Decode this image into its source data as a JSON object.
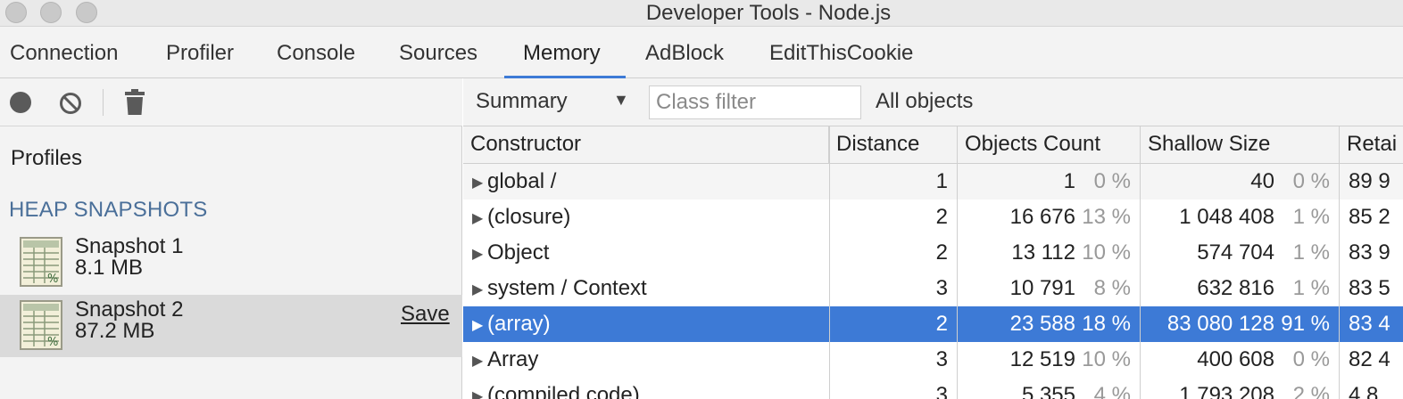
{
  "window": {
    "title": "Developer Tools - Node.js"
  },
  "tabs": [
    {
      "label": "Connection",
      "active": false
    },
    {
      "label": "Profiler",
      "active": false
    },
    {
      "label": "Console",
      "active": false
    },
    {
      "label": "Sources",
      "active": false
    },
    {
      "label": "Memory",
      "active": true
    },
    {
      "label": "AdBlock",
      "active": false
    },
    {
      "label": "EditThisCookie",
      "active": false
    }
  ],
  "sidebar": {
    "profiles_label": "Profiles",
    "section_label": "HEAP SNAPSHOTS",
    "snapshots": [
      {
        "name": "Snapshot 1",
        "size": "8.1 MB",
        "selected": false,
        "save_label": ""
      },
      {
        "name": "Snapshot 2",
        "size": "87.2 MB",
        "selected": true,
        "save_label": "Save"
      }
    ]
  },
  "toolbar": {
    "view": "Summary",
    "class_filter_placeholder": "Class filter",
    "class_filter_value": "",
    "scope": "All objects"
  },
  "table": {
    "columns": [
      "Constructor",
      "Distance",
      "Objects Count",
      "Shallow Size",
      "Retai"
    ],
    "rows": [
      {
        "name": "global /",
        "distance": "1",
        "count": "1",
        "count_pct": "0 %",
        "shallow": "40",
        "shallow_pct": "0 %",
        "retained": "89 9",
        "style": "alt"
      },
      {
        "name": "(closure)",
        "distance": "2",
        "count": "16 676",
        "count_pct": "13 %",
        "shallow": "1 048 408",
        "shallow_pct": "1 %",
        "retained": "85 2",
        "style": ""
      },
      {
        "name": "Object",
        "distance": "2",
        "count": "13 112",
        "count_pct": "10 %",
        "shallow": "574 704",
        "shallow_pct": "1 %",
        "retained": "83 9",
        "style": ""
      },
      {
        "name": "system / Context",
        "distance": "3",
        "count": "10 791",
        "count_pct": "8 %",
        "shallow": "632 816",
        "shallow_pct": "1 %",
        "retained": "83 5",
        "style": ""
      },
      {
        "name": "(array)",
        "distance": "2",
        "count": "23 588",
        "count_pct": "18 %",
        "shallow": "83 080 128",
        "shallow_pct": "91 %",
        "retained": "83 4",
        "style": "sel"
      },
      {
        "name": "Array",
        "distance": "3",
        "count": "12 519",
        "count_pct": "10 %",
        "shallow": "400 608",
        "shallow_pct": "0 %",
        "retained": "82 4",
        "style": ""
      },
      {
        "name": "(compiled code)",
        "distance": "3",
        "count": "5 355",
        "count_pct": "4 %",
        "shallow": "1 793 208",
        "shallow_pct": "2 %",
        "retained": "4 8",
        "style": ""
      }
    ]
  },
  "colors": {
    "accent": "#3d7ad6",
    "selected_row": "#3d7ad6",
    "section_label": "#4a6f99"
  }
}
